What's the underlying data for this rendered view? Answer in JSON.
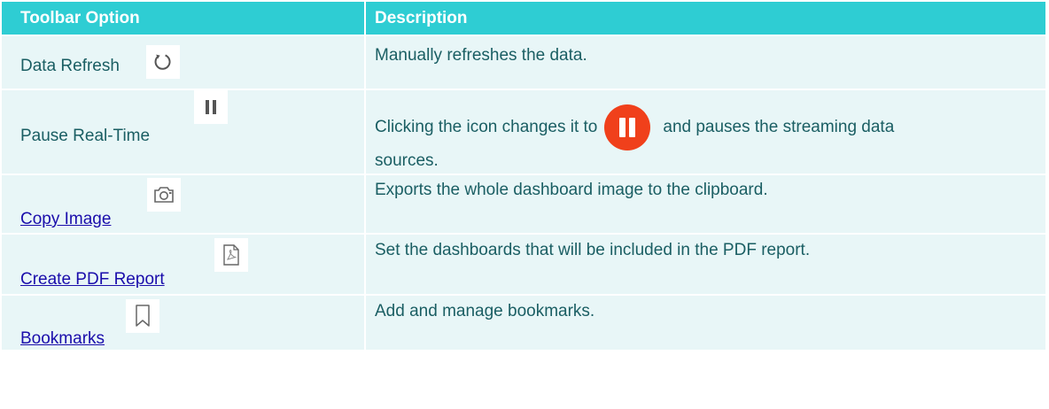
{
  "table": {
    "headers": [
      "Toolbar Option",
      "Description"
    ],
    "rows": [
      {
        "option": "Data Refresh",
        "is_link": false,
        "icon": "refresh-icon",
        "description": "Manually refreshes the data."
      },
      {
        "option": "Pause Real-Time",
        "is_link": false,
        "icon": "pause-icon",
        "description_before": "Clicking the icon changes it to",
        "description_after": "and pauses the streaming data",
        "description_line2": "sources.",
        "inline_icon": "pause-circle-red-icon"
      },
      {
        "option": "Copy Image",
        "is_link": true,
        "icon": "camera-icon",
        "description": "Exports the whole dashboard image to the clipboard."
      },
      {
        "option": "Create PDF Report",
        "is_link": true,
        "icon": "pdf-file-icon",
        "description": "Set the dashboards that will be included in the PDF report."
      },
      {
        "option": "Bookmarks",
        "is_link": true,
        "icon": "bookmark-icon",
        "description": "Add and manage bookmarks."
      }
    ]
  },
  "colors": {
    "header_bg": "#2ecdd3",
    "row_bg": "#e8f6f7",
    "text": "#1a5e63",
    "link": "#1a0dab",
    "pause_red": "#f0401b"
  }
}
